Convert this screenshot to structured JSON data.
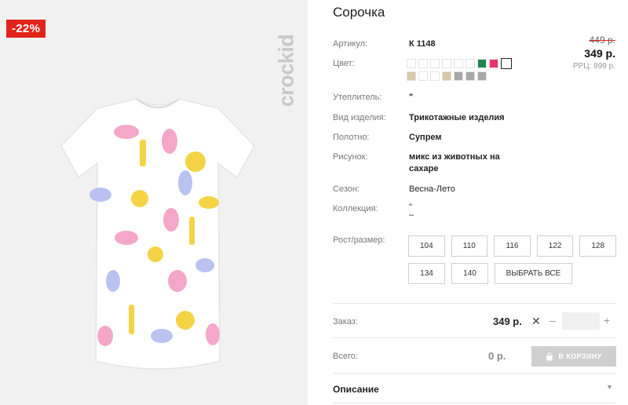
{
  "product": {
    "title": "Сорочка",
    "discount": "-22%",
    "brand": "crockid"
  },
  "prices": {
    "old": "449 р.",
    "current": "349 р.",
    "rrp": "РРЦ: 899 р."
  },
  "attributes": {
    "article_label": "Артикул:",
    "article_value": "К 1148",
    "color_label": "Цвет:",
    "insulation_label": "Утеплитель:",
    "insulation_value": "\"",
    "type_label": "Вид изделия:",
    "type_value": "Трикотажные изделия",
    "fabric_label": "Полотно:",
    "fabric_value": "Супрем",
    "pattern_label": "Рисунок:",
    "pattern_value_line1": "микс из животных на",
    "pattern_value_line2": "сахаре",
    "season_label": "Сезон:",
    "season_value": "Весна-Лето",
    "collection_label": "Коллекция:",
    "collection_value_line1": "\"",
    "collection_value_line2": "–"
  },
  "colors": {
    "row1": [
      "#ffffff",
      "#ffffff",
      "#ffffff",
      "#ffffff",
      "#ffffff",
      "#ffffff",
      "#1f8a4c",
      "#e8336d",
      "#ffffff"
    ],
    "row2": [
      "#d8c8a8",
      "#ffffff",
      "#ffffff",
      "#d8c8a8",
      "#a8a8a8",
      "#a8a8a8",
      "#a8a8a8"
    ]
  },
  "sizes": {
    "label": "Рост/размер:",
    "row1": [
      "104",
      "110",
      "116",
      "122",
      "128"
    ],
    "row2": [
      "134",
      "140"
    ],
    "select_all": "ВЫБРАТЬ ВСЕ"
  },
  "order": {
    "label": "Заказ:",
    "price": "349 р.",
    "times": "✕",
    "minus": "–",
    "plus": "+",
    "quantity": ""
  },
  "total": {
    "label": "Всего:",
    "value": "0 р.",
    "cart_button": "В КОРЗИНУ"
  },
  "description": {
    "label": "Описание",
    "chevron": "▼"
  },
  "accent_color": "#e2231a"
}
